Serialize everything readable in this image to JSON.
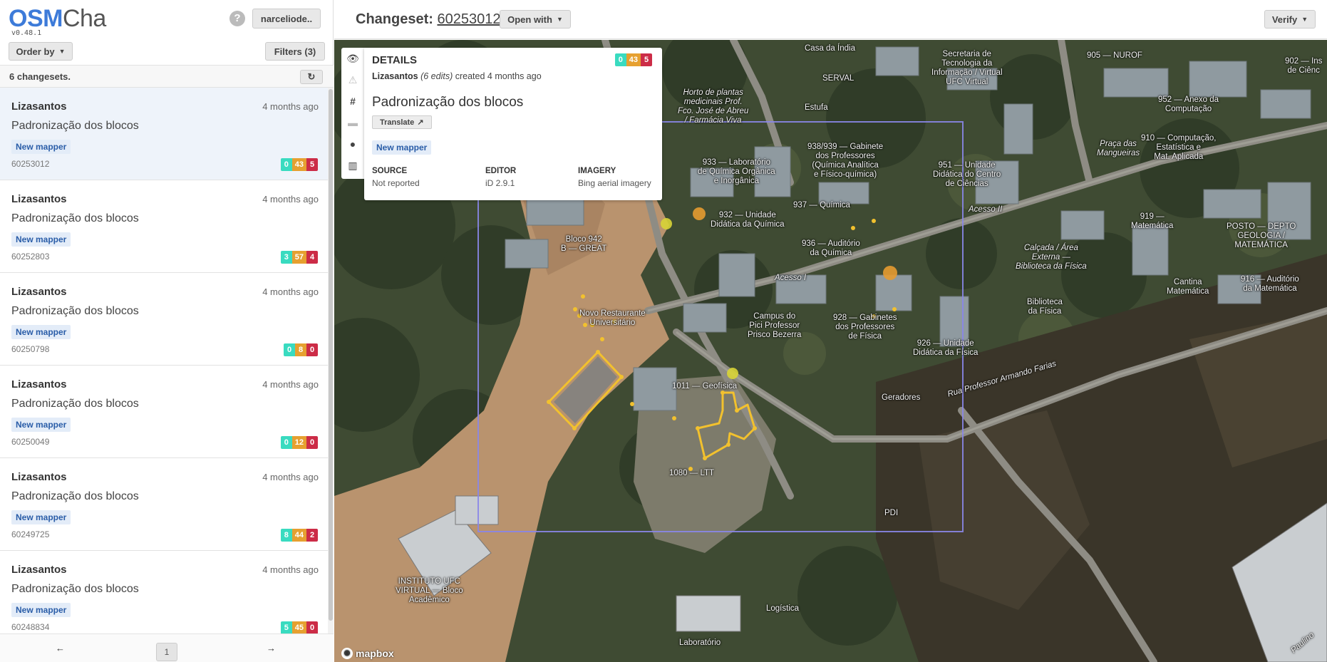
{
  "app": {
    "logo_osm": "OSM",
    "logo_cha": "Cha",
    "version": "v0.48.1"
  },
  "top": {
    "help": "?",
    "user": "narceliode.."
  },
  "controls": {
    "order_by": "Order by",
    "filters": "Filters (3)",
    "count": "6 changesets.",
    "refresh_icon": "↻"
  },
  "changesets": [
    {
      "user": "Lizasantos",
      "time": "4 months ago",
      "comment": "Padronização dos blocos",
      "tag": "New mapper",
      "id": "60253012",
      "add": "0",
      "mod": "43",
      "del": "5"
    },
    {
      "user": "Lizasantos",
      "time": "4 months ago",
      "comment": "Padronização dos blocos",
      "tag": "New mapper",
      "id": "60252803",
      "add": "3",
      "mod": "57",
      "del": "4"
    },
    {
      "user": "Lizasantos",
      "time": "4 months ago",
      "comment": "Padronização dos blocos",
      "tag": "New mapper",
      "id": "60250798",
      "add": "0",
      "mod": "8",
      "del": "0"
    },
    {
      "user": "Lizasantos",
      "time": "4 months ago",
      "comment": "Padronização dos blocos",
      "tag": "New mapper",
      "id": "60250049",
      "add": "0",
      "mod": "12",
      "del": "0"
    },
    {
      "user": "Lizasantos",
      "time": "4 months ago",
      "comment": "Padronização dos blocos",
      "tag": "New mapper",
      "id": "60249725",
      "add": "8",
      "mod": "44",
      "del": "2"
    },
    {
      "user": "Lizasantos",
      "time": "4 months ago",
      "comment": "Padronização dos blocos",
      "tag": "New mapper",
      "id": "60248834",
      "add": "5",
      "mod": "45",
      "del": "0"
    }
  ],
  "pager": {
    "prev": "←",
    "current": "1",
    "next": "→"
  },
  "header": {
    "label": "Changeset: ",
    "id": "60253012",
    "open_with": "Open with",
    "verify": "Verify"
  },
  "details": {
    "heading": "DETAILS",
    "user": "Lizasantos",
    "edits": "(6 edits)",
    "created": "created 4 months ago",
    "title": "Padronização dos blocos",
    "translate": "Translate",
    "tag": "New mapper",
    "add": "0",
    "mod": "43",
    "del": "5",
    "source_key": "SOURCE",
    "source_val": "Not reported",
    "editor_key": "EDITOR",
    "editor_val": "iD 2.9.1",
    "imagery_key": "IMAGERY",
    "imagery_val": "Bing aerial imagery"
  },
  "map": {
    "attribution": "mapbox",
    "labels": [
      "Casa da Índia",
      "SERVAL",
      "Secretaria de\nTecnologia da\nInformação / Virtual\nUFC Virtual",
      "905 — NUROF",
      "902 — Ins\nde Ciênc",
      "Horto de plantas\nmedicinais Prof.\nFco. José de Abreu\n/ Farmácia Viva",
      "Estufa",
      "938/939 — Gabinete\ndos Professores\n(Química Analítica\ne Físico-química)",
      "933 — Laboratório\nde Química Orgânica\ne Inorgânica",
      "951 — Unidade\nDidática do Centro\nde Ciências",
      "952 — Anexo da\nComputação",
      "Praça das\nMangueiras",
      "910 — Computação,\nEstatística e\nMat. Aplicada",
      "937 — Química",
      "932 — Unidade\nDidática da Química",
      "936 — Auditório\nda Química",
      "Acesso II",
      "919 —\nMatemática",
      "POSTO — DEPTO\nGEOLOGIA /\nMATEMÁTICA",
      "Calçada / Área\nExterna —\nBiblioteca da Física",
      "Bloco 942\nB — GREAT",
      "Biblioteca\nda Física",
      "Cantina\nMatemática",
      "916 — Auditório\nda Matemática",
      "Acesso I",
      "Novo Restaurante\nUniversitário",
      "Campus do\nPici Professor\nPrisco Bezerra",
      "928 — Gabinetes\ndos Professores\nde Física",
      "926 — Unidade\nDidática da Física",
      "Rua Professor Armando Farias",
      "1011 — Geofísica",
      "Geradores",
      "1080 — LTT",
      "PDI",
      "INSTITUTO UFC\nVIRTUAL — Bloco\nAcadêmico",
      "Logística",
      "Laboratório",
      "Paulino"
    ]
  }
}
